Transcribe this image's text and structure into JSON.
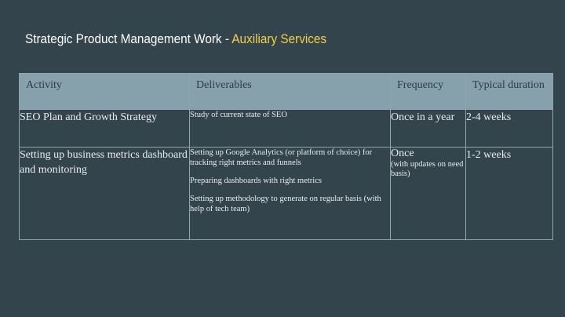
{
  "title": {
    "main": "Strategic Product Management Work - ",
    "accent": "Auxiliary Services"
  },
  "colors": {
    "background": "#34444d",
    "header_row": "#86a0ac",
    "accent": "#f0d14a"
  },
  "table": {
    "headers": [
      "Activity",
      "Deliverables",
      "Frequency",
      "Typical duration"
    ],
    "rows": [
      {
        "activity": "SEO Plan and Growth Strategy",
        "deliverables": [
          "Study of current state of SEO"
        ],
        "frequency": "Once in a year",
        "frequency_note": "",
        "duration": "2-4 weeks"
      },
      {
        "activity": "Setting up business metrics dashboard and monitoring",
        "deliverables": [
          "Setting up Google Analytics (or platform of choice) for tracking right metrics and funnels",
          "Preparing dashboards with right metrics",
          "Setting up methodology to generate on regular basis (with help of tech team)"
        ],
        "frequency": "Once",
        "frequency_note": "(with updates on need basis)",
        "duration": "1-2 weeks"
      }
    ]
  }
}
